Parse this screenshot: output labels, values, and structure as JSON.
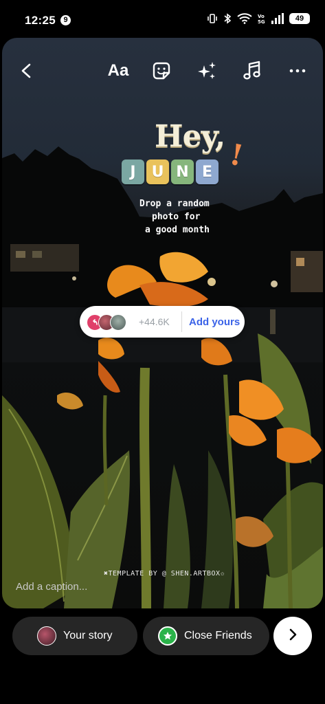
{
  "status_bar": {
    "time": "12:25",
    "notification_count": "9",
    "battery": "49",
    "icons": [
      "vibrate-icon",
      "bluetooth-icon",
      "wifi-icon",
      "volte-icon",
      "signal-icon",
      "battery-icon"
    ]
  },
  "toolbar": {
    "back_icon": "chevron-left-icon",
    "text_label": "Aa",
    "sticker_icon": "sticker-icon",
    "effects_icon": "sparkles-icon",
    "music_icon": "music-note-icon",
    "more_icon": "more-horizontal-icon"
  },
  "sticker": {
    "hey": "Hey,",
    "exclamation": "!",
    "june_letters": [
      "J",
      "U",
      "N",
      "E"
    ],
    "june_colors": [
      "#7ba7a3",
      "#e9c25c",
      "#86b67c",
      "#8ea8cf"
    ],
    "line1": "Drop a random",
    "line2": "photo for",
    "line3": "a good month"
  },
  "add_yours": {
    "count": "+44.6K",
    "label": "Add yours",
    "accent": "#3b63e8",
    "icon": "add-yours-icon"
  },
  "template_credit": "✖TEMPLATE BY @ SHEN.ARTBOX✩",
  "caption": {
    "placeholder": "Add a caption..."
  },
  "bottom_bar": {
    "your_story_label": "Your story",
    "close_friends_label": "Close Friends",
    "close_friends_color": "#2bb34a",
    "next_icon": "chevron-right-icon"
  }
}
